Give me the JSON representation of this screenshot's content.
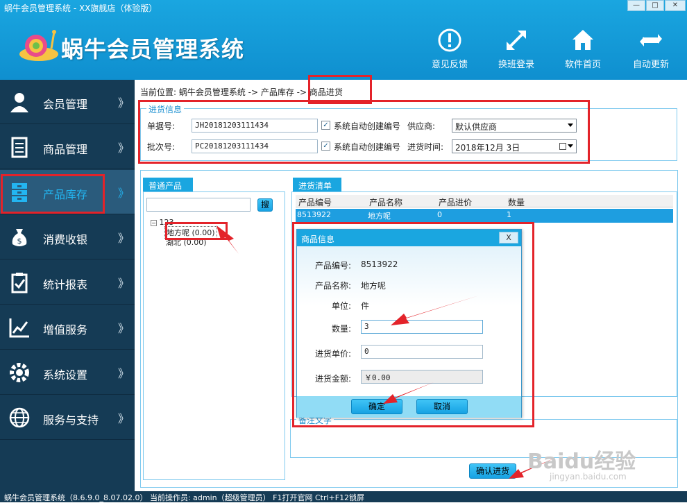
{
  "window": {
    "title": "蜗牛会员管理系统 - XX旗舰店（体验版）",
    "min_label": "—",
    "max_label": "□",
    "close_label": "✕"
  },
  "header": {
    "app_title": "蜗牛会员管理系统",
    "tools": [
      {
        "label": "意见反馈",
        "icon": "info-icon"
      },
      {
        "label": "换班登录",
        "icon": "expand-arrows-icon"
      },
      {
        "label": "软件首页",
        "icon": "home-icon"
      },
      {
        "label": "自动更新",
        "icon": "refresh-icon"
      }
    ]
  },
  "sidebar": {
    "items": [
      {
        "label": "会员管理",
        "icon": "member-icon",
        "chevron": "》"
      },
      {
        "label": "商品管理",
        "icon": "document-icon",
        "chevron": "》"
      },
      {
        "label": "产品库存",
        "icon": "cabinet-icon",
        "chevron": "》",
        "active": true
      },
      {
        "label": "消费收银",
        "icon": "money-bag-icon",
        "chevron": "》"
      },
      {
        "label": "统计报表",
        "icon": "clipboard-icon",
        "chevron": "》"
      },
      {
        "label": "增值服务",
        "icon": "chart-icon",
        "chevron": "》"
      },
      {
        "label": "系统设置",
        "icon": "gear-icon",
        "chevron": "》"
      },
      {
        "label": "服务与支持",
        "icon": "globe-icon",
        "chevron": "》"
      }
    ]
  },
  "main": {
    "breadcrumb": "当前位置: 蜗牛会员管理系统 -> 产品库存 -> 商品进货",
    "purchase_info": {
      "title": "进货信息",
      "order_no_label": "单据号:",
      "order_no_value": "JH20181203111434",
      "auto_number_label": "系统自动创建编号",
      "supplier_label": "供应商:",
      "supplier_value": "默认供应商",
      "batch_no_label": "批次号:",
      "batch_no_value": "PC20181203111434",
      "auto_number_label2": "系统自动创建编号",
      "purchase_time_label": "进货时间:",
      "purchase_time_value": "2018年12月  3日"
    },
    "product_panel": {
      "tab": "普通产品",
      "search_button": "搜",
      "search_value": "",
      "tree": {
        "root": "123",
        "children": [
          "地方呢 (0.00)",
          "湖北 (0.00)"
        ]
      }
    },
    "purchase_list": {
      "tab": "进货清单",
      "columns": [
        "产品编号",
        "产品名称",
        "产品进价",
        "数量"
      ],
      "rows": [
        {
          "code": "8513922",
          "name": "地方呢",
          "price": "0",
          "qty": "1"
        }
      ]
    },
    "remarks_label": "备注文字",
    "confirm_button": "确认进货"
  },
  "dialog": {
    "title": "商品信息",
    "close_label": "X",
    "fields": {
      "code_label": "产品编号:",
      "code_value": "8513922",
      "name_label": "产品名称:",
      "name_value": "地方呢",
      "unit_label": "单位:",
      "unit_value": "件",
      "qty_label": "数量:",
      "qty_value": "3",
      "price_label": "进货单价:",
      "price_value": "0",
      "amount_label": "进货金额:",
      "amount_value": "￥0.00"
    },
    "ok_button": "确定",
    "cancel_button": "取消"
  },
  "statusbar": {
    "text": "蜗牛会员管理系统（8.6.9.0_8.07.02.0）  当前操作员: admin（超级管理员）  F1打开官网 Ctrl+F12锁屏"
  },
  "watermark": {
    "brand": "Baidu经验",
    "url": "jingyan.baidu.com"
  },
  "colors": {
    "header": "#1aa6e0",
    "sidebar": "#153b55",
    "accent": "#23b5f1",
    "annotation": "#e3232a"
  }
}
